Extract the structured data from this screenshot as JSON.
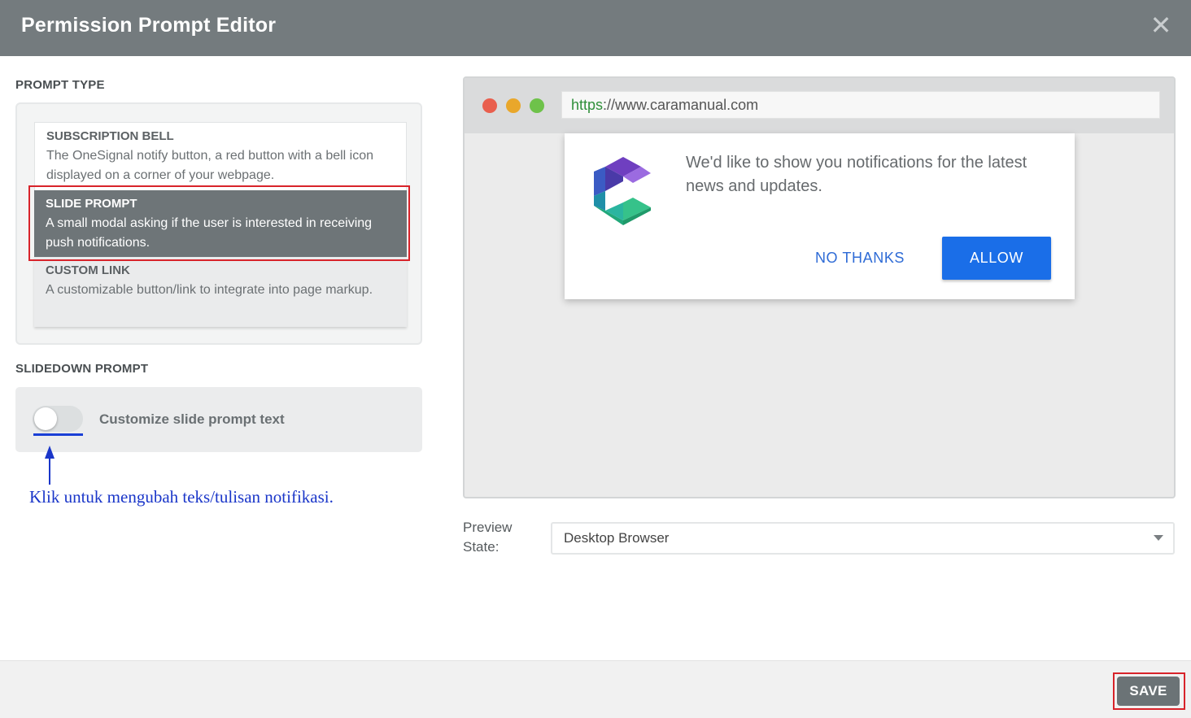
{
  "window": {
    "title": "Permission Prompt Editor",
    "close_glyph": "✕",
    "close_icon": "close-icon"
  },
  "prompt_type": {
    "heading": "PROMPT TYPE",
    "options": [
      {
        "title": "SUBSCRIPTION BELL",
        "description": "The OneSignal notify button, a red button with a bell icon displayed on a corner of your webpage.",
        "selected": false
      },
      {
        "title": "SLIDE PROMPT",
        "description": "A small modal asking if the user is interested in receiving push notifications.",
        "selected": true
      },
      {
        "title": "CUSTOM LINK",
        "description": "A customizable button/link to integrate into page markup.",
        "selected": false
      }
    ]
  },
  "slidedown": {
    "heading": "SLIDEDOWN PROMPT",
    "toggle_label": "Customize slide prompt text",
    "toggle_on": false
  },
  "annotation": {
    "text": "Klik untuk mengubah teks/tulisan notifikasi.",
    "color": "#1a36c9",
    "highlight_color": "#d8232a"
  },
  "preview": {
    "url_scheme": "https",
    "url_rest": "://www.caramanual.com",
    "message": "We'd like to show you notifications for the latest news and updates.",
    "no_thanks_label": "NO THANKS",
    "allow_label": "ALLOW",
    "logo_icon": "caramanual-logo-icon"
  },
  "preview_state": {
    "label": "Preview State:",
    "selected": "Desktop Browser"
  },
  "footer": {
    "save_label": "SAVE"
  },
  "colors": {
    "titlebar": "#747b7e",
    "selected_option": "#6e7578",
    "allow_button": "#1a6ee8",
    "link_text": "#2e6bd6"
  }
}
